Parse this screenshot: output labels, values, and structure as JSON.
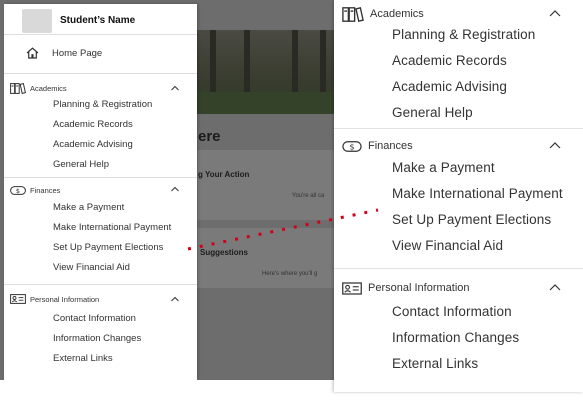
{
  "background_app": {
    "heading_partial": "ere",
    "card1_title": "g Your Action",
    "card1_text": "You're all ca",
    "card2_title": "Suggestions",
    "card2_text": "Here's where you'll g"
  },
  "drawer": {
    "student_name": "Student’s Name",
    "home_label": "Home Page",
    "sections": [
      {
        "title": "Academics",
        "icon": "books-icon",
        "items": [
          "Planning & Registration",
          "Academic Records",
          "Academic Advising",
          "General Help"
        ]
      },
      {
        "title": "Finances",
        "icon": "dollar-icon",
        "items": [
          "Make a Payment",
          "Make International Payment",
          "Set Up Payment Elections",
          "View Financial Aid"
        ]
      },
      {
        "title": "Personal Information",
        "icon": "id-card-icon",
        "items": [
          "Contact Information",
          "Information Changes",
          "External Links"
        ]
      }
    ]
  },
  "zoom": {
    "sections": [
      {
        "title": "Academics",
        "items": [
          "Planning & Registration",
          "Academic Records",
          "Academic Advising",
          "General Help"
        ]
      },
      {
        "title": "Finances",
        "items": [
          "Make a Payment",
          "Make International Payment",
          "Set Up Payment Elections",
          "View Financial Aid"
        ]
      },
      {
        "title": "Personal Information",
        "items": [
          "Contact Information",
          "Information Changes",
          "External Links"
        ]
      }
    ]
  },
  "colors": {
    "callout_dots": "#d0021b",
    "overlay": "#6d6d6d"
  }
}
